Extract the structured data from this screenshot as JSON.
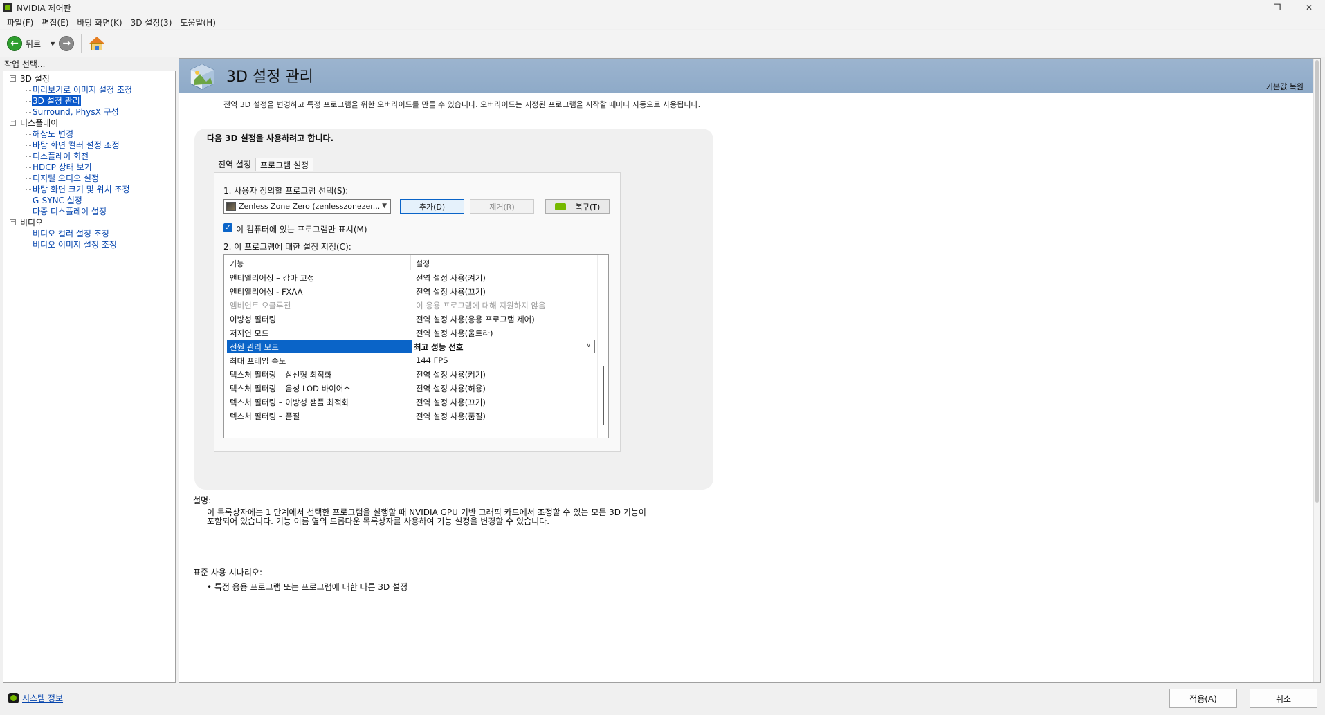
{
  "window": {
    "title": "NVIDIA 제어판",
    "minimize": "—",
    "maximize": "❐",
    "close": "✕"
  },
  "menu": [
    "파일(F)",
    "편집(E)",
    "바탕 화면(K)",
    "3D 설정(3)",
    "도움말(H)"
  ],
  "toolbar": {
    "back_label": "뒤로",
    "back_glyph": "←",
    "forward_glyph": "→",
    "dropdown_glyph": "▼"
  },
  "sidebar": {
    "header": "작업 선택...",
    "categories": [
      {
        "label": "3D 설정",
        "toggle": "−",
        "items": [
          "미리보기로 이미지 설정 조정",
          "3D 설정 관리",
          "Surround, PhysX 구성"
        ]
      },
      {
        "label": "디스플레이",
        "toggle": "−",
        "items": [
          "해상도 변경",
          "바탕 화면 컬러 설정 조정",
          "디스플레이 회전",
          "HDCP 상태 보기",
          "디지털 오디오 설정",
          "바탕 화면 크기 및 위치 조정",
          "G-SYNC 설정",
          "다중 디스플레이 설정"
        ]
      },
      {
        "label": "비디오",
        "toggle": "−",
        "items": [
          "비디오 컬러 설정 조정",
          "비디오 이미지 설정 조정"
        ]
      }
    ],
    "selected_item": "3D 설정 관리",
    "system_info": "시스템 정보"
  },
  "page": {
    "title": "3D 설정 관리",
    "restore_defaults": "기본값 복원",
    "description": "전역 3D 설정을 변경하고 특정 프로그램을 위한 오버라이드를 만들 수 있습니다. 오버라이드는 지정된 프로그램을 시작할 때마다 자동으로 사용됩니다.",
    "section_title": "다음 3D 설정을 사용하려고 합니다.",
    "tabs": [
      "전역 설정",
      "프로그램 설정"
    ],
    "active_tab": "프로그램 설정",
    "step1_label": "1. 사용자 정의할 프로그램 선택(S):",
    "program_selected": "Zenless Zone Zero (zenlesszonezer...",
    "add_button": "추가(D)",
    "remove_button": "제거(R)",
    "restore_button": "복구(T)",
    "only_installed_checkbox": "이 컴퓨터에 있는 프로그램만 표시(M)",
    "only_installed_checked": true,
    "step2_label": "2. 이 프로그램에 대한 설정 지정(C):",
    "list_columns": [
      "기능",
      "설정"
    ],
    "settings_rows": [
      {
        "feature": "앤티엘리어싱 – 감마 교정",
        "value": "전역 설정 사용(켜기)",
        "state": "normal"
      },
      {
        "feature": "앤티엘리어싱 - FXAA",
        "value": "전역 설정 사용(끄기)",
        "state": "normal"
      },
      {
        "feature": "앰비언트 오클루전",
        "value": "이 응용 프로그램에 대해 지원하지 않음",
        "state": "dim"
      },
      {
        "feature": "이방성 필터링",
        "value": "전역 설정 사용(응용 프로그램 제어)",
        "state": "normal"
      },
      {
        "feature": "저지연 모드",
        "value": "전역 설정 사용(울트라)",
        "state": "normal"
      },
      {
        "feature": "전원 관리 모드",
        "value": "최고 성능 선호",
        "state": "selected"
      },
      {
        "feature": "최대 프레임 속도",
        "value": "144 FPS",
        "state": "normal"
      },
      {
        "feature": "텍스처 필터링 – 삼선형 최적화",
        "value": "전역 설정 사용(켜기)",
        "state": "normal"
      },
      {
        "feature": "텍스처 필터링 – 음성 LOD 바이어스",
        "value": "전역 설정 사용(허용)",
        "state": "normal"
      },
      {
        "feature": "텍스처 필터링 – 이방성 샘플 최적화",
        "value": "전역 설정 사용(끄기)",
        "state": "normal"
      },
      {
        "feature": "텍스처 필터링 – 품질",
        "value": "전역 설정 사용(품질)",
        "state": "normal"
      }
    ],
    "description_label": "설명:",
    "description_body_line1": "이 목록상자에는 1 단계에서 선택한 프로그램을 실행할 때 NVIDIA GPU 기반 그래픽 카드에서 조정할 수 있는 모든 3D 기능이",
    "description_body_line2": "포함되어 있습니다. 기능 이름 옆의 드롭다운 목록상자를 사용하여 기능 설정을 변경할 수 있습니다.",
    "scenarios_label": "표준 사용 시나리오:",
    "scenario_item": "• 특정 응용 프로그램 또는 프로그램에 대한 다른 3D 설정"
  },
  "footer": {
    "apply": "적용(A)",
    "cancel": "취소"
  },
  "colors": {
    "accent": "#0a64c8",
    "banner": "#9cb4cf",
    "nvidia_green": "#76b900",
    "link": "#0645ad"
  }
}
